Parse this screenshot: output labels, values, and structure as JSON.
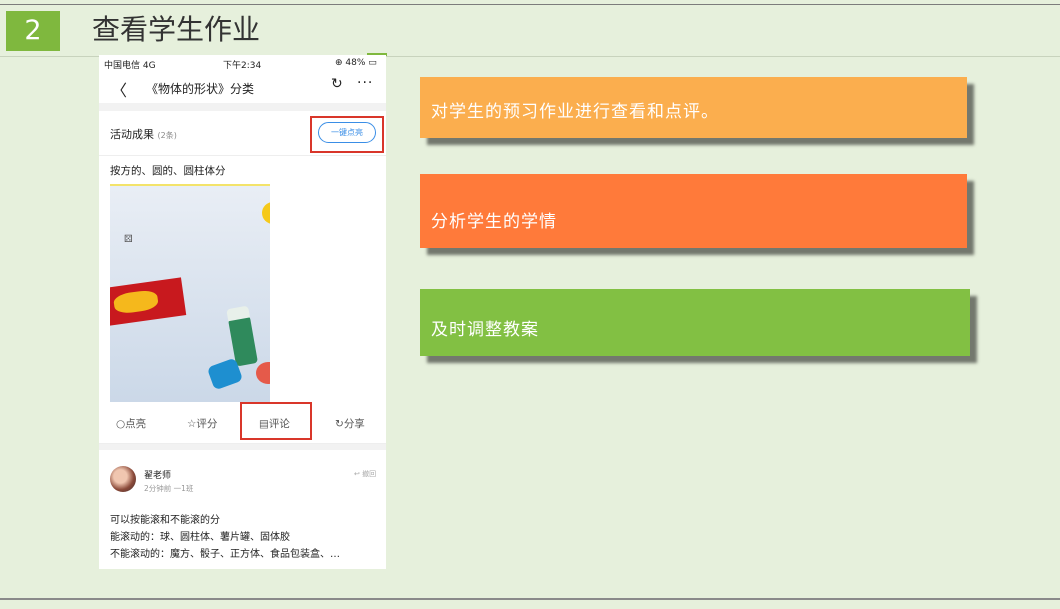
{
  "slide": {
    "number": "2",
    "title": "查看学生作业"
  },
  "phone": {
    "status": {
      "carrier": "中国电信 4G",
      "time": "下午2:34",
      "battery": "48%"
    },
    "nav": {
      "back_icon": "chevron-left-icon",
      "title": "《物体的形状》分类",
      "refresh_icon": "refresh-icon",
      "more_icon": "ellipsis-icon"
    },
    "section": {
      "label": "活动成果",
      "count": "(2条)",
      "like_all_button": "一键点亮"
    },
    "post": {
      "text": "按方的、圆的、圆柱体分"
    },
    "actions": [
      {
        "label": "点亮",
        "icon": "bulb-icon"
      },
      {
        "label": "评分",
        "icon": "star-icon"
      },
      {
        "label": "评论",
        "icon": "comment-icon"
      },
      {
        "label": "分享",
        "icon": "share-icon"
      }
    ],
    "comment": {
      "author": "翟老师",
      "meta": "2分钟前 一1班",
      "reply": "撤回",
      "lines": [
        "可以按能滚和不能滚的分",
        "能滚动的：球、圆柱体、薯片罐、固体胶",
        "不能滚动的：魔方、骰子、正方体、食品包装盒、…"
      ]
    }
  },
  "callouts": [
    {
      "text": "对学生的预习作业进行查看和点评。",
      "color": "#fbae4e"
    },
    {
      "text": "分析学生的学情",
      "color": "#ff7a3a"
    },
    {
      "text": "及时调整教案",
      "color": "#82c043"
    }
  ],
  "colors": {
    "background": "#e6f0dc",
    "accent_green": "#7fb83e",
    "highlight_red": "#d9362a",
    "link_blue": "#3a8ee6"
  }
}
